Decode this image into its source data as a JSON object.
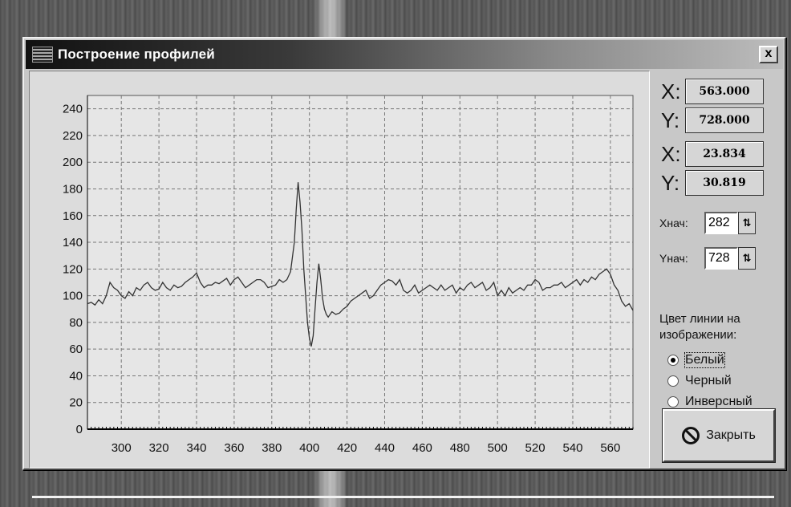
{
  "window": {
    "title": "Построение профилей",
    "close_glyph": "x"
  },
  "coords": {
    "x_label": "X:",
    "y_label": "Y:",
    "x1": "563.000",
    "y1": "728.000",
    "x2": "23.834",
    "y2": "30.819"
  },
  "start": {
    "x_label": "Xнач:",
    "x_value": "282",
    "y_label": "Yнач:",
    "y_value": "728"
  },
  "line_color": {
    "label": "Цвет линии на изображении:",
    "options": [
      "Белый",
      "Черный",
      "Инверсный"
    ],
    "selected": "Белый"
  },
  "close_button": {
    "label": "Закрыть"
  },
  "icons": {
    "app": "profile-app-icon",
    "close": "close-icon",
    "spin": "spin-arrows-icon",
    "stop": "no-entry-icon"
  },
  "chart_data": {
    "type": "line",
    "x_ticks": [
      300,
      320,
      340,
      360,
      380,
      400,
      420,
      440,
      460,
      480,
      500,
      520,
      540,
      560
    ],
    "y_ticks": [
      0,
      20,
      40,
      60,
      80,
      100,
      120,
      140,
      160,
      180,
      200,
      220,
      240
    ],
    "xlim": [
      282,
      572
    ],
    "ylim": [
      0,
      250
    ],
    "grid": true,
    "series": [
      {
        "color": "#333333",
        "x": [
          282,
          284,
          286,
          288,
          290,
          292,
          294,
          296,
          298,
          300,
          302,
          304,
          306,
          308,
          310,
          312,
          314,
          316,
          318,
          320,
          322,
          324,
          326,
          328,
          330,
          332,
          334,
          336,
          338,
          340,
          342,
          344,
          346,
          348,
          350,
          352,
          354,
          356,
          358,
          360,
          362,
          364,
          366,
          368,
          370,
          372,
          374,
          376,
          378,
          380,
          382,
          384,
          386,
          388,
          390,
          392,
          393,
          394,
          395,
          396,
          397,
          398,
          399,
          400,
          401,
          402,
          403,
          404,
          405,
          406,
          407,
          408,
          409,
          410,
          412,
          414,
          416,
          418,
          420,
          422,
          424,
          426,
          428,
          430,
          432,
          434,
          436,
          438,
          440,
          442,
          444,
          446,
          448,
          450,
          452,
          454,
          456,
          458,
          460,
          462,
          464,
          466,
          468,
          470,
          472,
          474,
          476,
          478,
          480,
          482,
          484,
          486,
          488,
          490,
          492,
          494,
          496,
          498,
          500,
          502,
          504,
          506,
          508,
          510,
          512,
          514,
          516,
          518,
          520,
          522,
          524,
          526,
          528,
          530,
          532,
          534,
          536,
          538,
          540,
          542,
          544,
          546,
          548,
          550,
          552,
          554,
          556,
          558,
          560,
          562,
          564,
          566,
          568,
          570,
          572
        ],
        "values": [
          94,
          95,
          93,
          97,
          94,
          100,
          110,
          106,
          104,
          100,
          98,
          103,
          100,
          106,
          104,
          108,
          110,
          106,
          104,
          105,
          110,
          106,
          104,
          108,
          106,
          107,
          110,
          112,
          114,
          117,
          110,
          106,
          108,
          108,
          110,
          109,
          111,
          113,
          108,
          112,
          114,
          110,
          106,
          108,
          110,
          112,
          112,
          110,
          106,
          107,
          108,
          112,
          110,
          112,
          118,
          140,
          165,
          185,
          170,
          150,
          120,
          100,
          80,
          68,
          62,
          70,
          90,
          110,
          124,
          112,
          98,
          90,
          86,
          84,
          88,
          86,
          87,
          90,
          92,
          96,
          98,
          100,
          102,
          104,
          98,
          100,
          104,
          108,
          110,
          112,
          111,
          108,
          112,
          104,
          102,
          104,
          108,
          102,
          104,
          106,
          108,
          106,
          104,
          108,
          104,
          106,
          108,
          102,
          106,
          104,
          108,
          110,
          106,
          108,
          110,
          104,
          106,
          110,
          100,
          104,
          100,
          106,
          102,
          104,
          106,
          104,
          108,
          108,
          112,
          110,
          104,
          106,
          106,
          108,
          108,
          110,
          106,
          108,
          110,
          112,
          108,
          112,
          110,
          114,
          112,
          116,
          118,
          120,
          116,
          108,
          104,
          96,
          92,
          94,
          89
        ]
      }
    ]
  }
}
